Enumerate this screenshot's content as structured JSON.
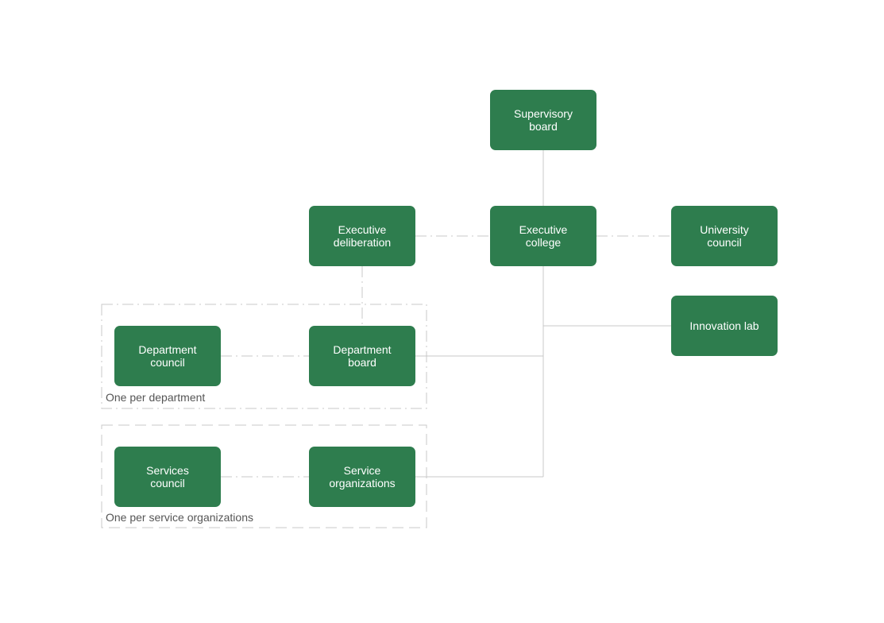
{
  "colors": {
    "node_fill": "#2e7d4e",
    "connector": "#c8c8c8",
    "group_border": "#c8c8c8"
  },
  "nodes": {
    "supervisory_board": "Supervisory\nboard",
    "executive_deliberation": "Executive\ndeliberation",
    "executive_college": "Executive\ncollege",
    "university_council": "University\ncouncil",
    "innovation_lab": "Innovation lab",
    "department_council": "Department\ncouncil",
    "department_board": "Department\nboard",
    "services_council": "Services\ncouncil",
    "service_organizations": "Service\norganizations"
  },
  "groups": {
    "department": "One per department",
    "service": "One per service organizations"
  }
}
